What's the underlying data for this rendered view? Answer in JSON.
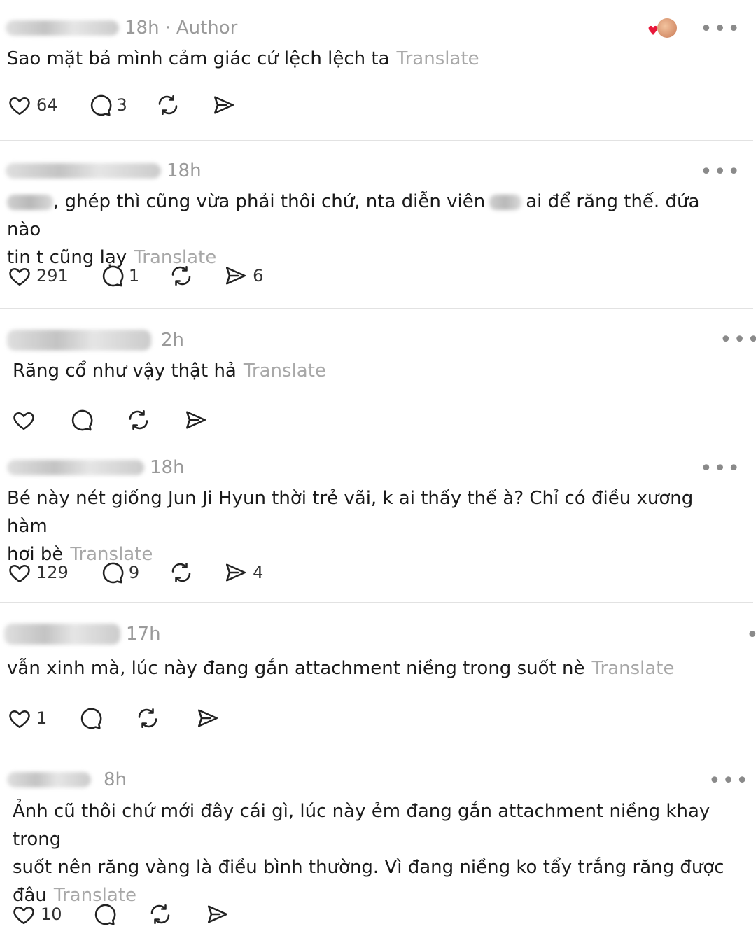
{
  "comments": [
    {
      "time": "18h",
      "author_label": "Author",
      "text": "Sao mặt bả mình cảm giác cứ lệch lệch ta",
      "translate": "Translate",
      "likes": "64",
      "replies": "3",
      "shares": ""
    },
    {
      "time": "18h",
      "text_a": ", ghép thì cũng vừa phải thôi chứ, nta diễn viên",
      "text_b": "ai để răng thế. đứa nào",
      "text_c": "tin t cũng lạy",
      "translate": "Translate",
      "likes": "291",
      "replies": "1",
      "shares": "6"
    },
    {
      "time": "2h",
      "text": "Răng cổ như vậy thật hả",
      "translate": "Translate",
      "likes": "",
      "replies": "",
      "shares": ""
    },
    {
      "time": "18h",
      "text_a": "Bé này nét giống Jun Ji Hyun thời trẻ vãi, k ai thấy thế à? Chỉ có điều xương hàm",
      "text_b": "hơi bè",
      "translate": "Translate",
      "likes": "129",
      "replies": "9",
      "shares": "4"
    },
    {
      "time": "17h",
      "text": "vẫn xinh mà, lúc này đang gắn attachment niềng trong suốt nè",
      "translate": "Translate",
      "likes": "1",
      "replies": "",
      "shares": ""
    },
    {
      "time": "8h",
      "text_a": "Ảnh cũ thôi chứ mới đây cái gì, lúc này ẻm đang gắn attachment niềng khay trong",
      "text_b": "suốt nên răng vàng là điều bình thường. Vì đang niềng ko tẩy trắng răng được",
      "text_c": "đâu",
      "translate": "Translate",
      "likes": "10",
      "replies": "",
      "shares": ""
    }
  ],
  "more_label": "•••",
  "icons": [
    "heart-icon",
    "comment-icon",
    "repost-icon",
    "share-icon",
    "more-icon"
  ],
  "colors": {
    "text": "#1a1a1a",
    "muted": "#9a9a9a",
    "translate": "#a8a8a8",
    "divider": "#e2e2e2",
    "heart": "#e8173a"
  }
}
